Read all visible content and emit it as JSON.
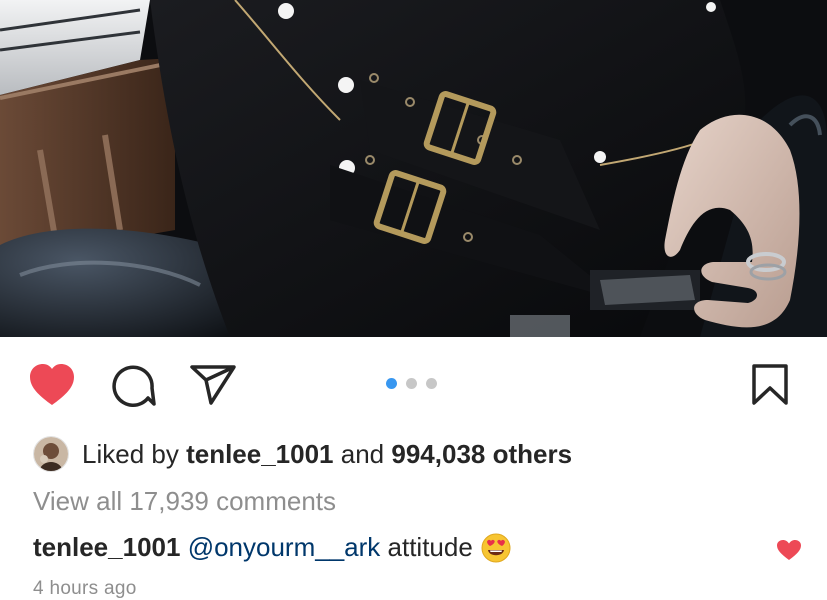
{
  "post": {
    "carousel": {
      "total": 3,
      "active_index": 0,
      "active_color": "#3897f0",
      "inactive_color": "#c7c7c7"
    },
    "like_icon": "heart-filled-icon",
    "comment_icon": "comment-bubble-icon",
    "share_icon": "paper-plane-icon",
    "save_icon": "bookmark-icon",
    "like_color": "#ed4956"
  },
  "likes": {
    "prefix": "Liked by",
    "user": "tenlee_1001",
    "joiner": "and",
    "others": "994,038 others"
  },
  "comments": {
    "view_all": "View all 17,939 comments",
    "top": {
      "username": "tenlee_1001",
      "mention": "@onyourm__ark",
      "text": "attitude",
      "emoji": "heart-eyes-emoji"
    }
  },
  "timestamp": "4 hours ago"
}
